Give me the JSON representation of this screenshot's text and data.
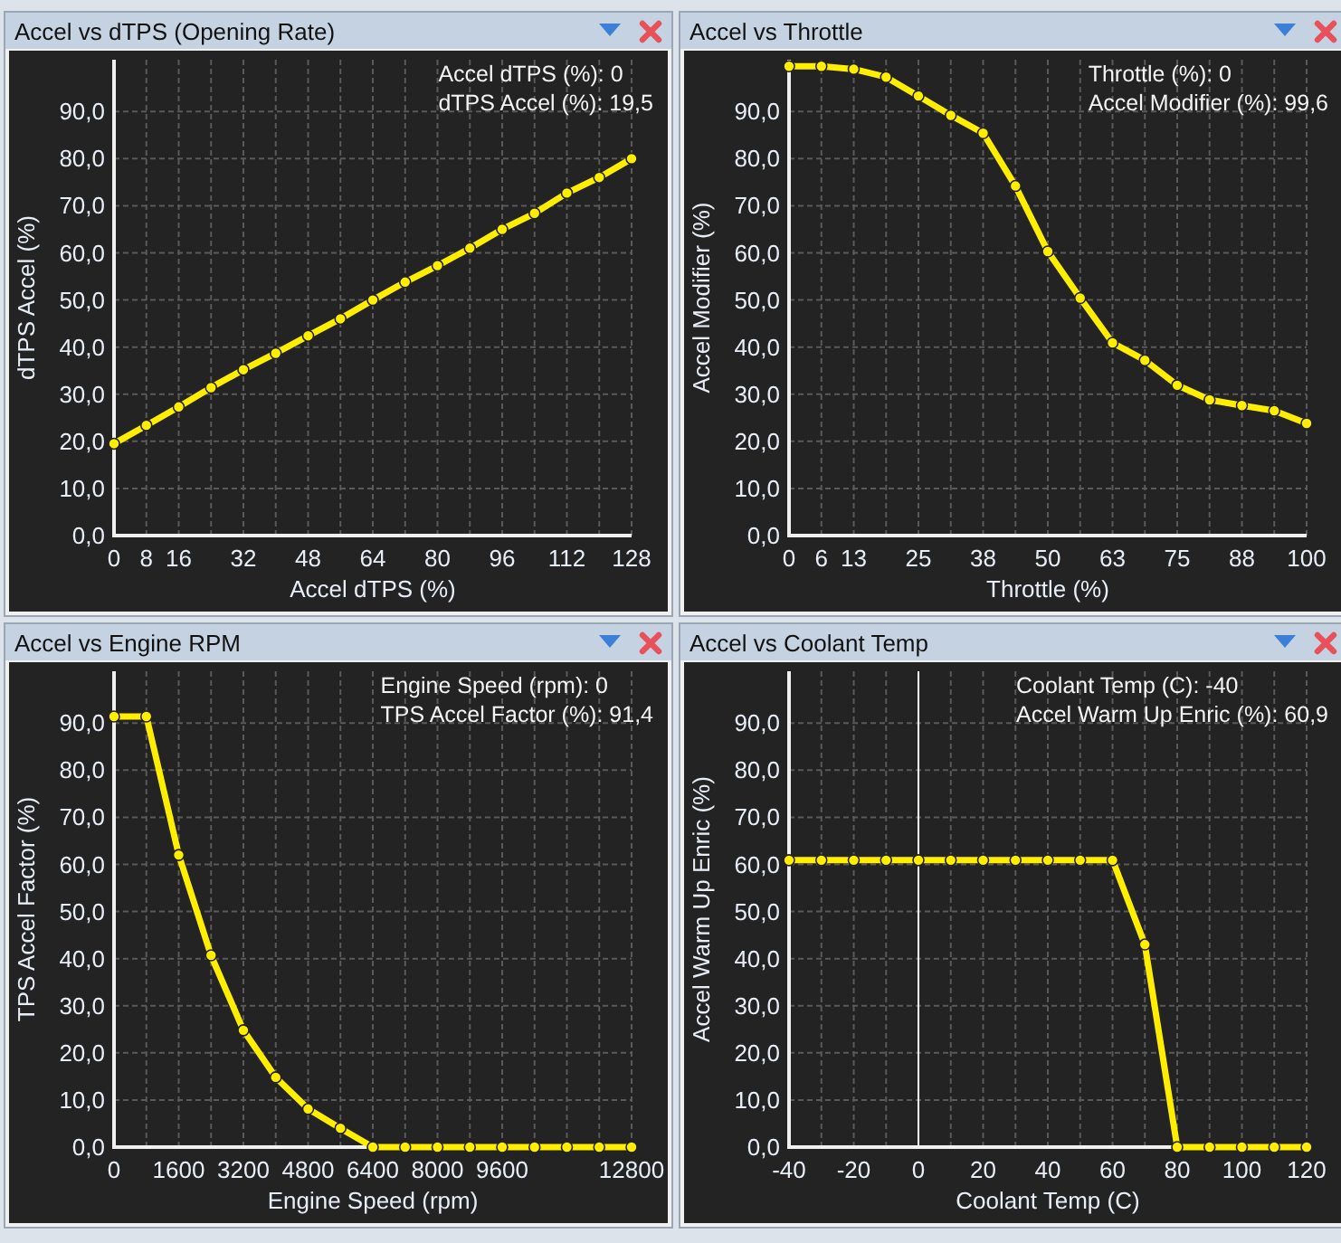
{
  "panels": [
    {
      "title": "Accel vs dTPS (Opening Rate)",
      "readouts": [
        "Accel dTPS (%): 0",
        "dTPS Accel (%): 19,5"
      ],
      "chart_data": {
        "type": "line",
        "xlabel": "Accel dTPS (%)",
        "ylabel": "dTPS Accel (%)",
        "x": [
          0,
          8,
          16,
          24,
          32,
          40,
          48,
          56,
          64,
          72,
          80,
          88,
          96,
          104,
          112,
          120,
          128
        ],
        "grid": true,
        "series": [
          {
            "marker": true,
            "color": "#ffee00",
            "values": [
              19.5,
              23.4,
              27.3,
              31.4,
              35.2,
              38.7,
              42.4,
              46,
              50,
              53.8,
              57.3,
              61,
              65,
              68.4,
              72.7,
              76,
              80
            ]
          }
        ],
        "xlim": [
          0,
          128
        ],
        "ylim": [
          0,
          101
        ],
        "xticks": [
          0,
          8,
          16,
          32,
          48,
          64,
          80,
          96,
          112,
          128
        ],
        "yticks": [
          {
            "value": 0,
            "label": "0,0"
          },
          {
            "value": 10,
            "label": "10,0"
          },
          {
            "value": 20,
            "label": "20,0"
          },
          {
            "value": 30,
            "label": "30,0"
          },
          {
            "value": 40,
            "label": "40,0"
          },
          {
            "value": 50,
            "label": "50,0"
          },
          {
            "value": 60,
            "label": "60,0"
          },
          {
            "value": 70,
            "label": "70,0"
          },
          {
            "value": 80,
            "label": "80,0"
          },
          {
            "value": 90,
            "label": "90,0"
          }
        ]
      }
    },
    {
      "title": "Accel vs Throttle",
      "readouts": [
        "Throttle (%): 0",
        "Accel Modifier (%): 99,6"
      ],
      "chart_data": {
        "type": "line",
        "xlabel": "Throttle (%)",
        "ylabel": "Accel Modifier (%)",
        "x": [
          0,
          6.25,
          12.5,
          18.75,
          25,
          31.25,
          37.5,
          43.75,
          50,
          56.25,
          62.5,
          68.75,
          75,
          81.25,
          87.5,
          93.75,
          100
        ],
        "grid": true,
        "series": [
          {
            "marker": true,
            "color": "#ffee00",
            "values": [
              99.6,
              99.6,
              99,
              97.3,
              93.3,
              89.2,
              85.4,
              74.2,
              60.3,
              50.4,
              40.9,
              37.2,
              31.9,
              28.8,
              27.6,
              26.5,
              23.8
            ]
          }
        ],
        "xlim": [
          0,
          100
        ],
        "ylim": [
          0,
          101
        ],
        "xticks": [
          0,
          {
            "value": 6.25,
            "label": "6"
          },
          {
            "value": 12.5,
            "label": "13"
          },
          25,
          {
            "value": 37.5,
            "label": "38"
          },
          50,
          {
            "value": 62.5,
            "label": "63"
          },
          75,
          {
            "value": 87.5,
            "label": "88"
          },
          100
        ],
        "yticks": [
          {
            "value": 0,
            "label": "0,0"
          },
          {
            "value": 10,
            "label": "10,0"
          },
          {
            "value": 20,
            "label": "20,0"
          },
          {
            "value": 30,
            "label": "30,0"
          },
          {
            "value": 40,
            "label": "40,0"
          },
          {
            "value": 50,
            "label": "50,0"
          },
          {
            "value": 60,
            "label": "60,0"
          },
          {
            "value": 70,
            "label": "70,0"
          },
          {
            "value": 80,
            "label": "80,0"
          },
          {
            "value": 90,
            "label": "90,0"
          }
        ]
      }
    },
    {
      "title": "Accel vs Engine RPM",
      "readouts": [
        "Engine Speed (rpm): 0",
        "TPS Accel Factor (%): 91,4"
      ],
      "chart_data": {
        "type": "line",
        "xlabel": "Engine Speed (rpm)",
        "ylabel": "TPS Accel Factor (%)",
        "x": [
          0,
          800,
          1600,
          2400,
          3200,
          4000,
          4800,
          5600,
          6400,
          7200,
          8000,
          8800,
          9600,
          10400,
          11200,
          12000,
          12800
        ],
        "grid": true,
        "series": [
          {
            "marker": true,
            "color": "#ffee00",
            "values": [
              91.4,
              91.4,
              62,
              40.7,
              24.8,
              14.8,
              8.1,
              4,
              0,
              0,
              0,
              0,
              0,
              0,
              0,
              0,
              0
            ]
          }
        ],
        "xlim": [
          0,
          12800
        ],
        "ylim": [
          0,
          101
        ],
        "xticks": [
          0,
          1600,
          3200,
          4800,
          6400,
          8000,
          9600,
          12800
        ],
        "yticks": [
          {
            "value": 0,
            "label": "0,0"
          },
          {
            "value": 10,
            "label": "10,0"
          },
          {
            "value": 20,
            "label": "20,0"
          },
          {
            "value": 30,
            "label": "30,0"
          },
          {
            "value": 40,
            "label": "40,0"
          },
          {
            "value": 50,
            "label": "50,0"
          },
          {
            "value": 60,
            "label": "60,0"
          },
          {
            "value": 70,
            "label": "70,0"
          },
          {
            "value": 80,
            "label": "80,0"
          },
          {
            "value": 90,
            "label": "90,0"
          }
        ]
      }
    },
    {
      "title": "Accel vs Coolant Temp",
      "readouts": [
        "Coolant Temp (C): -40",
        "Accel Warm Up Enric (%): 60,9"
      ],
      "chart_data": {
        "type": "line",
        "xlabel": "Coolant Temp (C)",
        "ylabel": "Accel Warm Up Enric (%)",
        "x": [
          -40,
          -30,
          -20,
          -10,
          0,
          10,
          20,
          30,
          40,
          50,
          60,
          70,
          80,
          90,
          100,
          110,
          120
        ],
        "grid": true,
        "series": [
          {
            "marker": true,
            "color": "#ffee00",
            "values": [
              60.9,
              60.9,
              60.9,
              60.9,
              60.9,
              60.9,
              60.9,
              60.9,
              60.9,
              60.9,
              60.9,
              43,
              0,
              0,
              0,
              0,
              0
            ]
          }
        ],
        "xlim": [
          -40,
          120
        ],
        "ylim": [
          0,
          101
        ],
        "xticks": [
          -40,
          -20,
          0,
          20,
          40,
          60,
          80,
          100,
          120
        ],
        "yticks": [
          {
            "value": 0,
            "label": "0,0"
          },
          {
            "value": 10,
            "label": "10,0"
          },
          {
            "value": 20,
            "label": "20,0"
          },
          {
            "value": 30,
            "label": "30,0"
          },
          {
            "value": 40,
            "label": "40,0"
          },
          {
            "value": 50,
            "label": "50,0"
          },
          {
            "value": 60,
            "label": "60,0"
          },
          {
            "value": 70,
            "label": "70,0"
          },
          {
            "value": 80,
            "label": "80,0"
          },
          {
            "value": 90,
            "label": "90,0"
          }
        ]
      }
    }
  ]
}
